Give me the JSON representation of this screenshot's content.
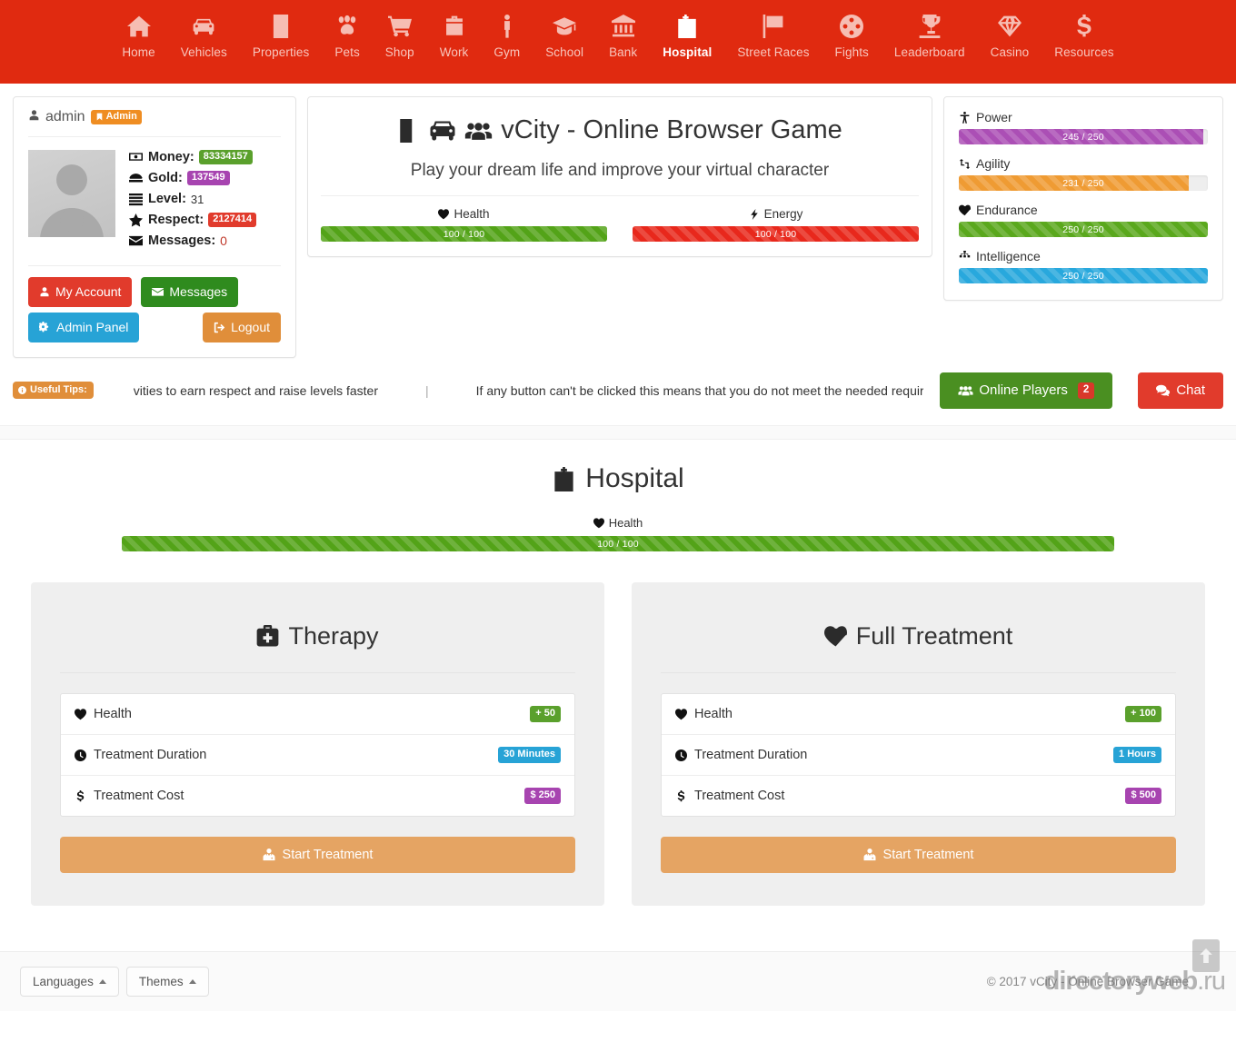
{
  "nav": {
    "items": [
      {
        "label": "Home",
        "icon": "home-icon",
        "active": false
      },
      {
        "label": "Vehicles",
        "icon": "car-icon",
        "active": false
      },
      {
        "label": "Properties",
        "icon": "building-icon",
        "active": false
      },
      {
        "label": "Pets",
        "icon": "paw-icon",
        "active": false
      },
      {
        "label": "Shop",
        "icon": "shopping-cart-icon",
        "active": false
      },
      {
        "label": "Work",
        "icon": "briefcase-icon",
        "active": false
      },
      {
        "label": "Gym",
        "icon": "person-icon",
        "active": false
      },
      {
        "label": "School",
        "icon": "graduation-cap-icon",
        "active": false
      },
      {
        "label": "Bank",
        "icon": "bank-icon",
        "active": false
      },
      {
        "label": "Hospital",
        "icon": "hospital-icon",
        "active": true
      },
      {
        "label": "Street Races",
        "icon": "checkered-flag-icon",
        "active": false
      },
      {
        "label": "Fights",
        "icon": "crosshairs-icon",
        "active": false
      },
      {
        "label": "Leaderboard",
        "icon": "trophy-icon",
        "active": false
      },
      {
        "label": "Casino",
        "icon": "diamond-icon",
        "active": false
      },
      {
        "label": "Resources",
        "icon": "dollar-icon",
        "active": false
      }
    ]
  },
  "user": {
    "username": "admin",
    "role_badge": "Admin",
    "stats": [
      {
        "icon": "money-bill-icon",
        "label": "Money:",
        "value": "83334157",
        "style": "badge",
        "color": "#5aa02c"
      },
      {
        "icon": "gold-icon",
        "label": "Gold:",
        "value": "137549",
        "style": "badge",
        "color": "#a744b0"
      },
      {
        "icon": "level-icon",
        "label": "Level:",
        "value": "31",
        "style": "plain",
        "color": "#333333"
      },
      {
        "icon": "star-icon",
        "label": "Respect:",
        "value": "2127414",
        "style": "badge",
        "color": "#e13b2c"
      },
      {
        "icon": "envelope-icon",
        "label": "Messages:",
        "value": "0",
        "style": "text-red",
        "color": "#c0392b"
      }
    ],
    "buttons": {
      "my_account": "My Account",
      "messages": "Messages",
      "admin_panel": "Admin Panel",
      "logout": "Logout"
    }
  },
  "hero": {
    "title": "vCity - Online Browser Game",
    "subtitle": "Play your dream life and improve your virtual character",
    "bars": [
      {
        "label": "Health",
        "icon": "heart-icon",
        "text": "100 / 100",
        "percent": 100,
        "color": "#53a318"
      },
      {
        "label": "Energy",
        "icon": "bolt-icon",
        "text": "100 / 100",
        "percent": 100,
        "color": "#e8281c"
      }
    ]
  },
  "attributes": [
    {
      "label": "Power",
      "icon": "power-icon",
      "text": "245 / 250",
      "percent": 98,
      "color": "#ab4fb5"
    },
    {
      "label": "Agility",
      "icon": "retweet-icon",
      "text": "231 / 250",
      "percent": 92.4,
      "color": "#ef9b33"
    },
    {
      "label": "Endurance",
      "icon": "heartbeat-icon",
      "text": "250 / 250",
      "percent": 100,
      "color": "#5aa81d"
    },
    {
      "label": "Intelligence",
      "icon": "sitemap-icon",
      "text": "250 / 250",
      "percent": 100,
      "color": "#28a8dd"
    }
  ],
  "tips": {
    "tag": "Useful Tips:",
    "tag_icon": "info-circle-icon",
    "messages": [
      "vities to earn respect and raise levels faster",
      "If any button can't be clicked this means that you do not meet the needed requirer"
    ],
    "separator": "|",
    "online_players_label": "Online Players",
    "online_players_count": "2",
    "online_players_icon": "users-icon",
    "chat_label": "Chat",
    "chat_icon": "comments-icon"
  },
  "hospital": {
    "title": "Hospital",
    "title_icon": "hospital-icon",
    "health_bar": {
      "label": "Health",
      "icon": "heart-icon",
      "text": "100 / 100",
      "percent": 100,
      "color": "#53a318"
    },
    "cards": [
      {
        "title": "Therapy",
        "icon": "medkit-icon",
        "rows": [
          {
            "icon": "heart-icon",
            "label": "Health",
            "value": "+ 50",
            "color": "#5aa02c"
          },
          {
            "icon": "clock-icon",
            "label": "Treatment Duration",
            "value": "30 Minutes",
            "color": "#27a3d6"
          },
          {
            "icon": "dollar-icon",
            "label": "Treatment Cost",
            "value": "$ 250",
            "color": "#a744b0"
          }
        ],
        "button_label": "Start Treatment",
        "button_icon": "user-md-icon"
      },
      {
        "title": "Full Treatment",
        "icon": "heartbeat-icon",
        "rows": [
          {
            "icon": "heart-icon",
            "label": "Health",
            "value": "+ 100",
            "color": "#5aa02c"
          },
          {
            "icon": "clock-icon",
            "label": "Treatment Duration",
            "value": "1 Hours",
            "color": "#27a3d6"
          },
          {
            "icon": "dollar-icon",
            "label": "Treatment Cost",
            "value": "$ 500",
            "color": "#a744b0"
          }
        ],
        "button_label": "Start Treatment",
        "button_icon": "user-md-icon"
      }
    ]
  },
  "footer": {
    "languages_label": "Languages",
    "themes_label": "Themes",
    "copyright": "© 2017 vCity - Online Browser Game",
    "watermark": "directoryweb",
    "watermark_tld": ".ru",
    "to_top_icon": "arrow-up-icon"
  },
  "colors": {
    "navbar": "#e02a10",
    "card_bg": "#efefef",
    "accent_orange": "#e5a463"
  }
}
